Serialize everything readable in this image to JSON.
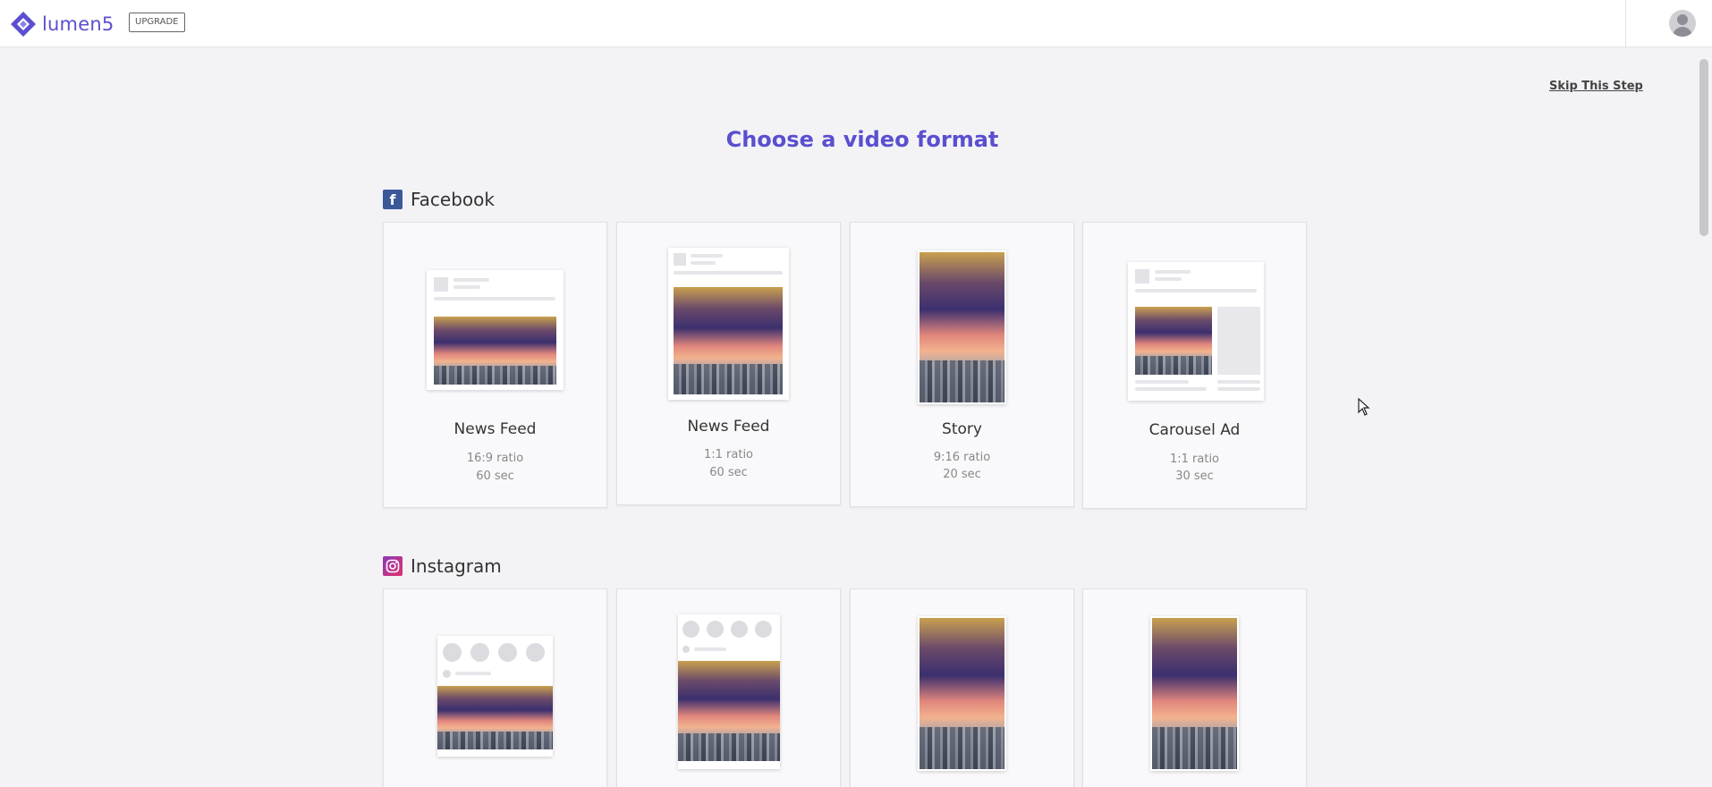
{
  "header": {
    "app_name": "lumen5",
    "upgrade_label": "UPGRADE"
  },
  "skip_label": "Skip This Step",
  "page_title": "Choose a video format",
  "sections": {
    "facebook": {
      "title": "Facebook",
      "icon": "facebook-icon",
      "cards": [
        {
          "name": "News Feed",
          "ratio": "16:9 ratio",
          "duration": "60 sec"
        },
        {
          "name": "News Feed",
          "ratio": "1:1 ratio",
          "duration": "60 sec"
        },
        {
          "name": "Story",
          "ratio": "9:16 ratio",
          "duration": "20 sec"
        },
        {
          "name": "Carousel Ad",
          "ratio": "1:1 ratio",
          "duration": "30 sec"
        }
      ]
    },
    "instagram": {
      "title": "Instagram",
      "icon": "instagram-icon"
    }
  },
  "colors": {
    "brand": "#5a4fd0",
    "facebook": "#3b5998",
    "instagram": "#c13584"
  }
}
